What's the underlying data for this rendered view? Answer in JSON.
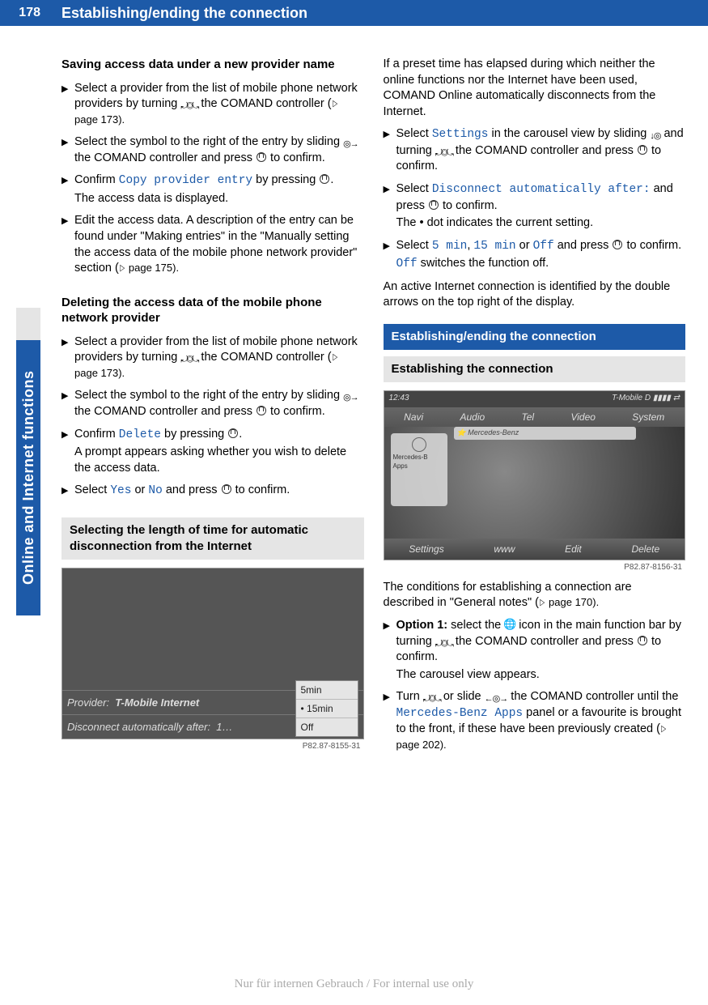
{
  "page": {
    "number": "178",
    "title": "Establishing/ending the connection"
  },
  "side_tab": "Online and Internet functions",
  "left": {
    "h_save": "Saving access data under a new provider name",
    "s1": "Select a provider from the list of mobile phone network providers by turning ",
    "s1b": " the COMAND controller (",
    "s1c": " page 173).",
    "s2": "Select the symbol to the right of the entry by sliding ",
    "s2b": " the COMAND controller and press ",
    "s2c": " to confirm.",
    "s3a": "Confirm ",
    "s3code": "Copy provider entry",
    "s3b": " by pressing ",
    "s3c": ".",
    "s3d": "The access data is displayed.",
    "s4": "Edit the access data. A description of the entry can be found under \"Making entries\" in the \"Manually setting the access data of the mobile phone network provider\" section (",
    "s4b": " page 175).",
    "h_del": "Deleting the access data of the mobile phone network provider",
    "d1": "Select a provider from the list of mobile phone network providers by turning ",
    "d1b": " the COMAND controller (",
    "d1c": " page 173).",
    "d2": "Select the symbol to the right of the entry by sliding ",
    "d2b": " the COMAND controller and press ",
    "d2c": " to confirm.",
    "d3a": "Confirm ",
    "d3code": "Delete",
    "d3b": " by pressing ",
    "d3c": ".",
    "d3d": "A prompt appears asking whether you wish to delete the access data.",
    "d4a": "Select ",
    "d4yes": "Yes",
    "d4or": " or ",
    "d4no": "No",
    "d4b": " and press ",
    "d4c": " to confirm.",
    "sec_auto": "Selecting the length of time for automatic disconnection from the Internet",
    "ss_provider_label": "Provider:",
    "ss_provider_val": "T-Mobile Internet",
    "ss_disc_label": "Disconnect automatically after:",
    "ss_disc_val": "1…",
    "ss_opt_5": "5min",
    "ss_opt_15": "15min",
    "ss_opt_off": "Off",
    "ss_caption1": "P82.87-8155-31"
  },
  "right": {
    "intro": "If a preset time has elapsed during which neither the online functions nor the Internet have been used, COMAND Online automatically disconnects from the Internet.",
    "r1a": "Select ",
    "r1code": "Settings",
    "r1b": " in the carousel view by sliding ",
    "r1c": " and turning ",
    "r1d": " the COMAND controller and press ",
    "r1e": " to confirm.",
    "r2a": "Select ",
    "r2code": "Disconnect automatically after:",
    "r2b": " and press ",
    "r2c": " to confirm.",
    "r2d": "The • dot indicates the current setting.",
    "r3a": "Select ",
    "r3_5": "5 min",
    "r3_c1": ", ",
    "r3_15": "15 min",
    "r3_c2": " or ",
    "r3_off": "Off",
    "r3b": " and press ",
    "r3c": " to confirm.",
    "r3d_off": "Off",
    "r3d": " switches the function off.",
    "active": "An active Internet connection is identified by the double arrows on the top right of the display.",
    "sec_est": "Establishing/ending the connection",
    "sub_est": "Establishing the connection",
    "ss_time": "12:43",
    "ss_carrier": "T-Mobile D",
    "ss_nav": "Navi",
    "ss_audio": "Audio",
    "ss_tel": "Tel",
    "ss_video": "Video",
    "ss_sys": "System",
    "ss_addr": "Mercedes-Benz",
    "ss_panel_label": "Mercedes-B\nApps",
    "ss_b1": "Settings",
    "ss_b2": "www",
    "ss_b3": "Edit",
    "ss_b4": "Delete",
    "ss_caption2": "P82.87-8156-31",
    "cond": "The conditions for establishing a connection are described in \"General notes\" (",
    "cond_b": " page 170).",
    "o1_label": "Option 1:",
    "o1a": " select the ",
    "o1b": " icon in the main function bar by turning ",
    "o1c": " the COMAND controller and press ",
    "o1d": " to confirm.",
    "o1e": "The carousel view appears.",
    "o2a": "Turn ",
    "o2b": " or slide ",
    "o2c": " the COMAND controller until the ",
    "o2code": "Mercedes-Benz Apps",
    "o2d": " panel or a favourite is brought to the front, if these have been previously created (",
    "o2e": " page 202)."
  },
  "footer": "Nur für internen Gebrauch / For internal use only"
}
